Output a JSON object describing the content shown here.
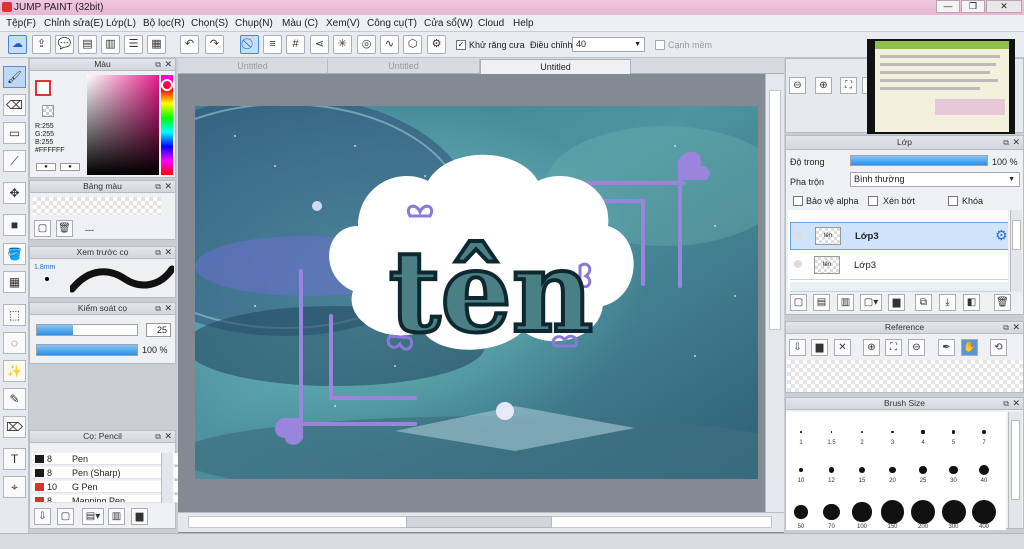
{
  "window": {
    "title": "JUMP PAINT (32bit)",
    "min_label": "—",
    "max_label": "❐",
    "close_label": "✕"
  },
  "menu": [
    "Tệp(F)",
    "Chỉnh sửa(E)",
    "Lớp(L)",
    "Bộ lọc(R)",
    "Chọn(S)",
    "Chụp(N)",
    "Màu (C)",
    "Xem(V)",
    "Công cụ(T)",
    "Cửa sổ(W)",
    "Cloud",
    "Help"
  ],
  "toolbar": {
    "antialias_label": "Khử răng cưa",
    "adjust_label": "Điều chỉnh",
    "adjust_value": "40",
    "edge_label": "Cạnh mềm"
  },
  "tabs": [
    "Untitled",
    "Untitled",
    "Untitled"
  ],
  "color_panel": {
    "title": "Màu",
    "r": "R:255",
    "g": "G:255",
    "b": "B:255",
    "hex": "#FFFFFF"
  },
  "palette_panel": {
    "title": "Bảng màu",
    "empty": "---"
  },
  "brush_preview_panel": {
    "title": "Xem trước cọ",
    "size": "1.8mm"
  },
  "brush_control_panel": {
    "title": "Kiểm soát cọ",
    "size_value": "25",
    "opacity_value": "100 %",
    "size_fraction": 0.36,
    "opacity_fraction": 1.0
  },
  "brush_list_panel": {
    "title": "Cọ: Pencil",
    "items": [
      {
        "size": "8",
        "name": "Pen",
        "color": "#1a1a1a"
      },
      {
        "size": "8",
        "name": "Pen (Sharp)",
        "color": "#1a1a1a"
      },
      {
        "size": "10",
        "name": "G Pen",
        "color": "#d9312b"
      },
      {
        "size": "8",
        "name": "Mapping Pen",
        "color": "#d9312b"
      }
    ]
  },
  "artwork": {
    "text": "tên"
  },
  "layer_panel": {
    "title": "Lớp",
    "opacity_label": "Độ trong",
    "opacity_value": "100 %",
    "opacity_fraction": 1.0,
    "blend_label": "Pha trộn",
    "blend_value": "Bình thường",
    "alpha_protect": "Bảo vệ alpha",
    "clip": "Xén bớt",
    "lock": "Khóa",
    "layers": [
      {
        "name": "Lớp3",
        "selected": true
      },
      {
        "name": "Lớp3",
        "selected": false
      }
    ]
  },
  "reference_panel": {
    "title": "Reference"
  },
  "brush_size_panel": {
    "title": "Brush Size",
    "sizes": [
      "1",
      "1.5",
      "2",
      "3",
      "4",
      "5",
      "7",
      "10",
      "12",
      "15",
      "20",
      "25",
      "30",
      "40",
      "50",
      "70",
      "100",
      "150",
      "200",
      "300",
      "400"
    ]
  }
}
